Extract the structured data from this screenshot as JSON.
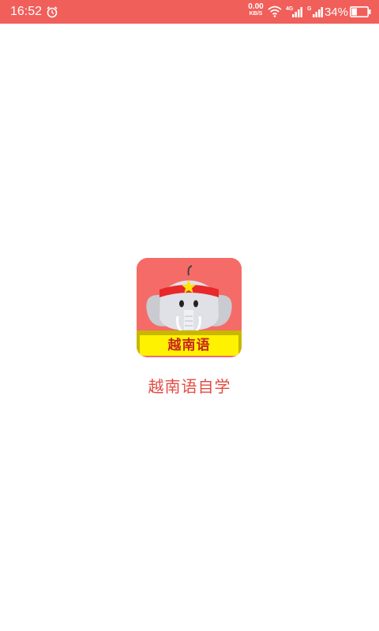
{
  "status_bar": {
    "time": "16:52",
    "net_speed_value": "0.00",
    "net_speed_unit": "KB/S",
    "network_type_1": "4G",
    "network_type_2": "G",
    "battery_percent": "34%",
    "battery_level": 0.34,
    "icons": [
      "alarm-icon",
      "wifi-icon",
      "signal-icon",
      "signal-icon",
      "battery-icon"
    ]
  },
  "splash": {
    "icon_label": "越南语",
    "app_title": "越南语自学"
  },
  "colors": {
    "status_bar_bg": "#f15f5b",
    "icon_bg": "#f56b67",
    "banner_yellow": "#fff200",
    "title_red": "#e34b44"
  }
}
